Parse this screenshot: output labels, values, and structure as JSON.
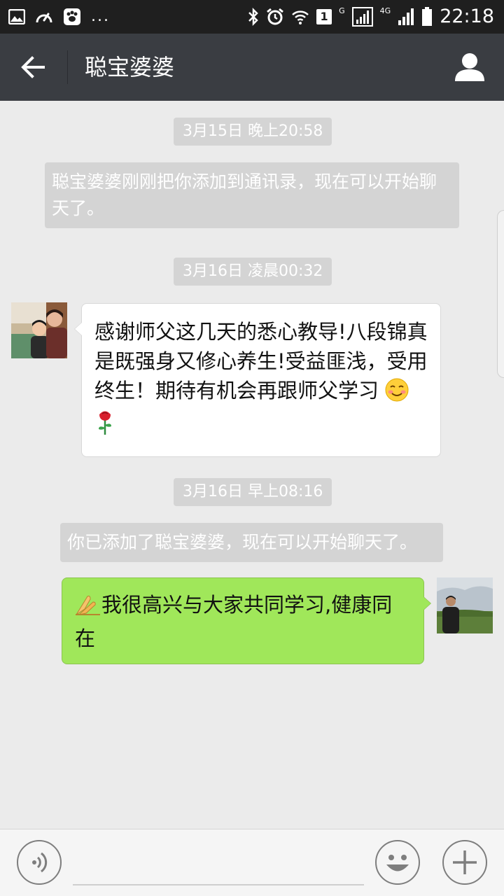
{
  "status_bar": {
    "dots": "...",
    "network_small": "G",
    "network_4g": "4G",
    "sim_badge": "1",
    "time": "22:18"
  },
  "header": {
    "title": "聪宝婆婆",
    "back_icon": "arrow-left-icon",
    "profile_icon": "person-icon"
  },
  "chat": {
    "messages": [
      {
        "kind": "timestamp",
        "text": "3月15日 晚上20:58"
      },
      {
        "kind": "system",
        "text": "聪宝婆婆刚刚把你添加到通讯录，现在可以开始聊天了。"
      },
      {
        "kind": "timestamp",
        "text": "3月16日 凌晨00:32"
      },
      {
        "kind": "incoming",
        "text": "感谢师父这几天的悉心教导!八段锦真是既强身又修心养生!受益匪浅，受用终生！期待有机会再跟师父学习",
        "emojis": [
          "smiling-blush-emoji",
          "rose-emoji"
        ]
      },
      {
        "kind": "timestamp",
        "text": "3月16日 早上08:16"
      },
      {
        "kind": "system",
        "text": "你已添加了聪宝婆婆，现在可以开始聊天了。"
      },
      {
        "kind": "outgoing",
        "text": "我很高兴与大家共同学习,健康同在",
        "emojis": [
          "praying-hands-emoji"
        ]
      }
    ]
  },
  "input_bar": {
    "voice_icon": "voice-icon",
    "emoji_icon": "smiley-icon",
    "more_icon": "plus-icon",
    "input_value": ""
  },
  "colors": {
    "status_bar": "#1f1f1f",
    "title_bar": "#3a3d42",
    "chat_background": "#ebebeb",
    "outgoing_bubble": "#a0e75a",
    "incoming_bubble": "#ffffff",
    "system_pill": "#d4d4d4"
  }
}
